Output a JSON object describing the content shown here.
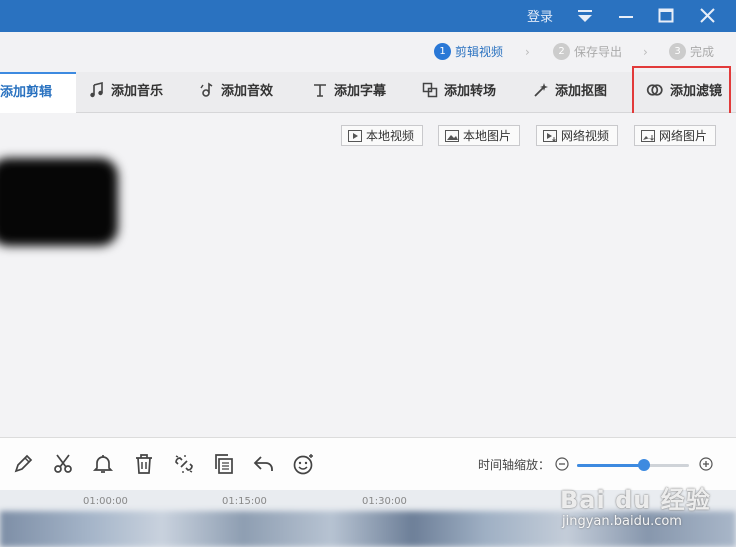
{
  "titlebar": {
    "login": "登录"
  },
  "steps": [
    {
      "num": "1",
      "label": "剪辑视频"
    },
    {
      "num": "2",
      "label": "保存导出"
    },
    {
      "num": "3",
      "label": "完成"
    }
  ],
  "tabs": [
    {
      "label": "添加剪辑"
    },
    {
      "label": "添加音乐"
    },
    {
      "label": "添加音效"
    },
    {
      "label": "添加字幕"
    },
    {
      "label": "添加转场"
    },
    {
      "label": "添加抠图"
    },
    {
      "label": "添加滤镜"
    }
  ],
  "source_buttons": [
    {
      "label": "本地视频"
    },
    {
      "label": "本地图片"
    },
    {
      "label": "网络视频"
    },
    {
      "label": "网络图片"
    }
  ],
  "timeline_zoom": {
    "label": "时间轴缩放：",
    "level": 0.6
  },
  "timeline": {
    "ticks": [
      "01:00:00",
      "01:15:00",
      "01:30:00"
    ]
  },
  "watermark": {
    "main": "Bai du 经验",
    "sub": "jingyan.baidu.com"
  },
  "colors": {
    "accent": "#2a72c0",
    "titlebar": "#2a72c0",
    "highlight": "#e23a3a"
  }
}
